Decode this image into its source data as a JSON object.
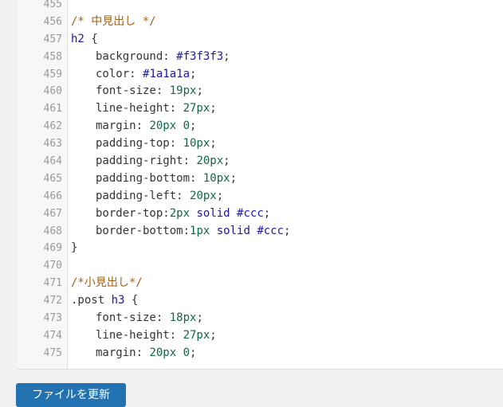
{
  "editor": {
    "lines": [
      {
        "n": "455",
        "tokens": []
      },
      {
        "n": "456",
        "tokens": [
          {
            "t": "/* 中見出し */",
            "c": "comment"
          }
        ]
      },
      {
        "n": "457",
        "tokens": [
          {
            "t": "h2",
            "c": "sel"
          },
          {
            "t": " {",
            "c": "punct"
          }
        ]
      },
      {
        "n": "458",
        "indent": 1,
        "tokens": [
          {
            "t": "background",
            "c": "prop"
          },
          {
            "t": ": ",
            "c": "punct"
          },
          {
            "t": "#f3f3f3",
            "c": "val"
          },
          {
            "t": ";",
            "c": "punct"
          }
        ]
      },
      {
        "n": "459",
        "indent": 1,
        "tokens": [
          {
            "t": "color",
            "c": "prop"
          },
          {
            "t": ": ",
            "c": "punct"
          },
          {
            "t": "#1a1a1a",
            "c": "val"
          },
          {
            "t": ";",
            "c": "punct"
          }
        ]
      },
      {
        "n": "460",
        "indent": 1,
        "tokens": [
          {
            "t": "font-size",
            "c": "prop"
          },
          {
            "t": ": ",
            "c": "punct"
          },
          {
            "t": "19px",
            "c": "num"
          },
          {
            "t": ";",
            "c": "punct"
          }
        ]
      },
      {
        "n": "461",
        "indent": 1,
        "tokens": [
          {
            "t": "line-height",
            "c": "prop"
          },
          {
            "t": ": ",
            "c": "punct"
          },
          {
            "t": "27px",
            "c": "num"
          },
          {
            "t": ";",
            "c": "punct"
          }
        ]
      },
      {
        "n": "462",
        "indent": 1,
        "tokens": [
          {
            "t": "margin",
            "c": "prop"
          },
          {
            "t": ": ",
            "c": "punct"
          },
          {
            "t": "20px 0",
            "c": "num"
          },
          {
            "t": ";",
            "c": "punct"
          }
        ]
      },
      {
        "n": "463",
        "indent": 1,
        "tokens": [
          {
            "t": "padding-top",
            "c": "prop"
          },
          {
            "t": ": ",
            "c": "punct"
          },
          {
            "t": "10px",
            "c": "num"
          },
          {
            "t": ";",
            "c": "punct"
          }
        ]
      },
      {
        "n": "464",
        "indent": 1,
        "tokens": [
          {
            "t": "padding-right",
            "c": "prop"
          },
          {
            "t": ": ",
            "c": "punct"
          },
          {
            "t": "20px",
            "c": "num"
          },
          {
            "t": ";",
            "c": "punct"
          }
        ]
      },
      {
        "n": "465",
        "indent": 1,
        "tokens": [
          {
            "t": "padding-bottom",
            "c": "prop"
          },
          {
            "t": ": ",
            "c": "punct"
          },
          {
            "t": "10px",
            "c": "num"
          },
          {
            "t": ";",
            "c": "punct"
          }
        ]
      },
      {
        "n": "466",
        "indent": 1,
        "tokens": [
          {
            "t": "padding-left",
            "c": "prop"
          },
          {
            "t": ": ",
            "c": "punct"
          },
          {
            "t": "20px",
            "c": "num"
          },
          {
            "t": ";",
            "c": "punct"
          }
        ]
      },
      {
        "n": "467",
        "indent": 1,
        "tokens": [
          {
            "t": "border-top",
            "c": "prop"
          },
          {
            "t": ":",
            "c": "punct"
          },
          {
            "t": "2px",
            "c": "num"
          },
          {
            "t": " solid ",
            "c": "atom"
          },
          {
            "t": "#ccc",
            "c": "val"
          },
          {
            "t": ";",
            "c": "punct"
          }
        ]
      },
      {
        "n": "468",
        "indent": 1,
        "tokens": [
          {
            "t": "border-bottom",
            "c": "prop"
          },
          {
            "t": ":",
            "c": "punct"
          },
          {
            "t": "1px",
            "c": "num"
          },
          {
            "t": " solid ",
            "c": "atom"
          },
          {
            "t": "#ccc",
            "c": "val"
          },
          {
            "t": ";",
            "c": "punct"
          }
        ]
      },
      {
        "n": "469",
        "tokens": [
          {
            "t": "}",
            "c": "punct"
          }
        ]
      },
      {
        "n": "470",
        "tokens": []
      },
      {
        "n": "471",
        "tokens": [
          {
            "t": "/*小見出し*/",
            "c": "comment"
          }
        ]
      },
      {
        "n": "472",
        "tokens": [
          {
            "t": ".post ",
            "c": "punct"
          },
          {
            "t": "h3",
            "c": "sel"
          },
          {
            "t": " {",
            "c": "punct"
          }
        ]
      },
      {
        "n": "473",
        "indent": 1,
        "tokens": [
          {
            "t": "font-size",
            "c": "prop"
          },
          {
            "t": ": ",
            "c": "punct"
          },
          {
            "t": "18px",
            "c": "num"
          },
          {
            "t": ";",
            "c": "punct"
          }
        ]
      },
      {
        "n": "474",
        "indent": 1,
        "tokens": [
          {
            "t": "line-height",
            "c": "prop"
          },
          {
            "t": ": ",
            "c": "punct"
          },
          {
            "t": "27px",
            "c": "num"
          },
          {
            "t": ";",
            "c": "punct"
          }
        ]
      },
      {
        "n": "475",
        "indent": 1,
        "tokens": [
          {
            "t": "margin",
            "c": "prop"
          },
          {
            "t": ": ",
            "c": "punct"
          },
          {
            "t": "20px 0",
            "c": "num"
          },
          {
            "t": ";",
            "c": "punct"
          }
        ]
      }
    ]
  },
  "update_button": {
    "label": "ファイルを更新"
  },
  "colors": {
    "button_bg": "#2271b1",
    "comment": "#a0611a",
    "number": "#116644",
    "value": "#1a1aa6"
  }
}
